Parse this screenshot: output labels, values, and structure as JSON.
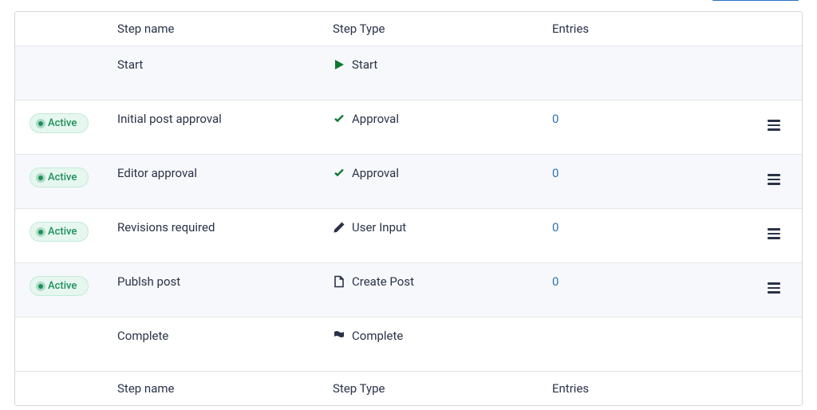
{
  "headers": {
    "step_name": "Step name",
    "step_type": "Step Type",
    "entries": "Entries"
  },
  "status_label": "Active",
  "rows": [
    {
      "name": "Start",
      "type": "Start",
      "entries": "",
      "has_status": false,
      "has_menu": false,
      "icon": "start"
    },
    {
      "name": "Initial post approval",
      "type": "Approval",
      "entries": "0",
      "has_status": true,
      "has_menu": true,
      "icon": "check"
    },
    {
      "name": "Editor approval",
      "type": "Approval",
      "entries": "0",
      "has_status": true,
      "has_menu": true,
      "icon": "check"
    },
    {
      "name": "Revisions required",
      "type": "User Input",
      "entries": "0",
      "has_status": true,
      "has_menu": true,
      "icon": "edit"
    },
    {
      "name": "Publsh post",
      "type": "Create Post",
      "entries": "0",
      "has_status": true,
      "has_menu": true,
      "icon": "file"
    },
    {
      "name": "Complete",
      "type": "Complete",
      "entries": "",
      "has_status": false,
      "has_menu": false,
      "icon": "flag"
    }
  ],
  "footers": {
    "step_name": "Step name",
    "step_type": "Step Type",
    "entries": "Entries"
  }
}
